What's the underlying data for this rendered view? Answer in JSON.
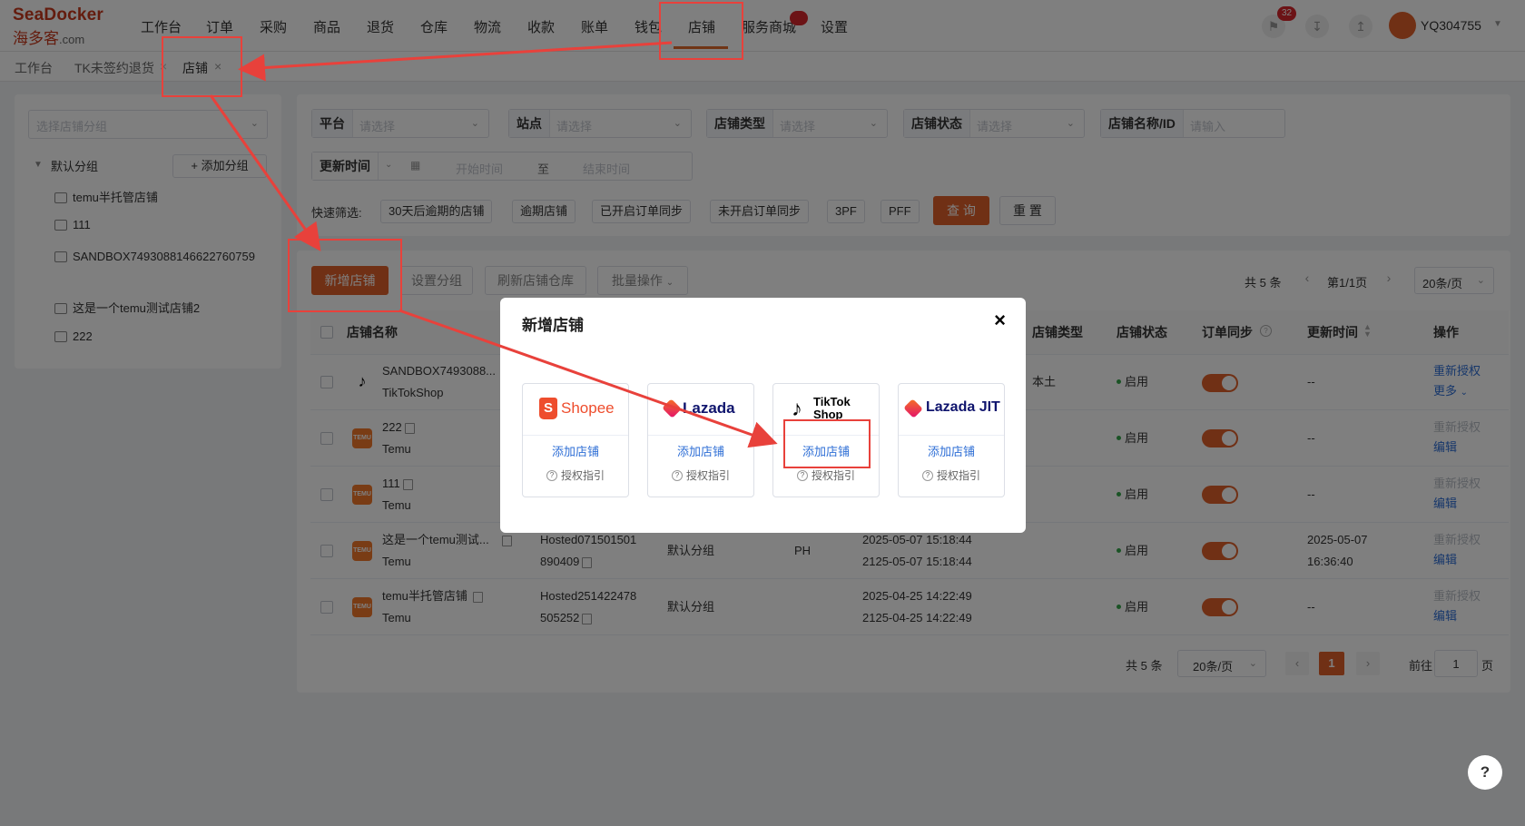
{
  "header": {
    "logo_top": "SeaDocker",
    "logo_cn": "海多客",
    "logo_dom": ".com",
    "nav": [
      "工作台",
      "订单",
      "采购",
      "商品",
      "退货",
      "仓库",
      "物流",
      "收款",
      "账单",
      "钱包",
      "店铺",
      "服务商城",
      "设置"
    ],
    "active_nav": "店铺",
    "notification_count": "32",
    "username": "YQ304755"
  },
  "tabs": {
    "items": [
      "工作台",
      "TK未签约退货",
      "店铺"
    ],
    "active": "店铺"
  },
  "sidebar": {
    "group_select_placeholder": "选择店铺分组",
    "default_group": "默认分组",
    "add_group_label": "+ 添加分组",
    "items": [
      "temu半托管店铺",
      "111",
      "SANDBOX7493088146622760759",
      "这是一个temu测试店铺2",
      "222"
    ]
  },
  "filters": {
    "platform_label": "平台",
    "platform_placeholder": "请选择",
    "site_label": "站点",
    "site_placeholder": "请选择",
    "store_type_label": "店铺类型",
    "store_type_placeholder": "请选择",
    "store_status_label": "店铺状态",
    "store_status_placeholder": "请选择",
    "store_name_label": "店铺名称/ID",
    "store_name_placeholder": "请输入",
    "update_time_label": "更新时间",
    "start_placeholder": "开始时间",
    "to_label": "至",
    "end_placeholder": "结束时间",
    "quick_label": "快速筛选:",
    "quick_chips": [
      "30天后逾期的店铺",
      "逾期店铺",
      "已开启订单同步",
      "未开启订单同步",
      "3PF",
      "PFF"
    ],
    "search_label": "查 询",
    "reset_label": "重 置"
  },
  "toolbar": {
    "add_store_label": "新增店铺",
    "set_group_label": "设置分组",
    "refresh_label": "刷新店铺仓库",
    "batch_label": "批量操作",
    "total_label": "共 5 条",
    "page_label": "第1/1页",
    "page_size": "20条/页"
  },
  "table": {
    "headers": {
      "name": "店铺名称",
      "type": "店铺类型",
      "status": "店铺状态",
      "sync": "订单同步",
      "update": "更新时间",
      "action": "操作"
    },
    "rows": [
      {
        "name": "SANDBOX7493088...",
        "platform": "TikTokShop",
        "id": "",
        "group": "",
        "site": "",
        "expire1": "",
        "expire2": "",
        "type": "本土",
        "status": "启用",
        "update1": "--",
        "update2": "",
        "action1": "重新授权",
        "action2": "更多"
      },
      {
        "name": "222",
        "platform": "Temu",
        "id": "",
        "group": "",
        "site": "",
        "expire1": "",
        "expire2": "",
        "type": "",
        "status": "启用",
        "update1": "--",
        "update2": "",
        "action1": "重新授权",
        "action2": "编辑"
      },
      {
        "name": "111",
        "platform": "Temu",
        "id": "",
        "group": "",
        "site": "",
        "expire1": "",
        "expire2": "",
        "type": "",
        "status": "启用",
        "update1": "--",
        "update2": "",
        "action1": "重新授权",
        "action2": "编辑"
      },
      {
        "name": "这是一个temu测试...",
        "platform": "Temu",
        "id1": "Hosted071501501",
        "id2": "890409",
        "group": "默认分组",
        "site": "PH",
        "expire1": "2025-05-07 15:18:44",
        "expire2": "2125-05-07 15:18:44",
        "type": "",
        "status": "启用",
        "update1": "2025-05-07",
        "update2": "16:36:40",
        "action1": "重新授权",
        "action2": "编辑"
      },
      {
        "name": "temu半托管店铺",
        "platform": "Temu",
        "id1": "Hosted251422478",
        "id2": "505252",
        "group": "默认分组",
        "site": "",
        "expire1": "2025-04-25 14:22:49",
        "expire2": "2125-04-25 14:22:49",
        "type": "",
        "status": "启用",
        "update1": "--",
        "update2": "",
        "action1": "重新授权",
        "action2": "编辑"
      }
    ]
  },
  "pagination": {
    "total": "共 5 条",
    "page_size": "20条/页",
    "current": "1",
    "goto_label": "前往",
    "goto_value": "1",
    "page_suffix": "页"
  },
  "modal": {
    "title": "新增店铺",
    "add_label": "添加店铺",
    "guide_label": "授权指引",
    "platforms": [
      {
        "name": "Shopee",
        "color": "#ee4d2d"
      },
      {
        "name": "Lazada",
        "color": "#0f146d"
      },
      {
        "name": "TikTok Shop",
        "color": "#000000"
      },
      {
        "name": "Lazada JIT",
        "color": "#0f146d"
      }
    ]
  },
  "help_label": "?",
  "colors": {
    "accent": "#e0612a",
    "annotation": "#e8413b",
    "link": "#2f6fd6"
  }
}
